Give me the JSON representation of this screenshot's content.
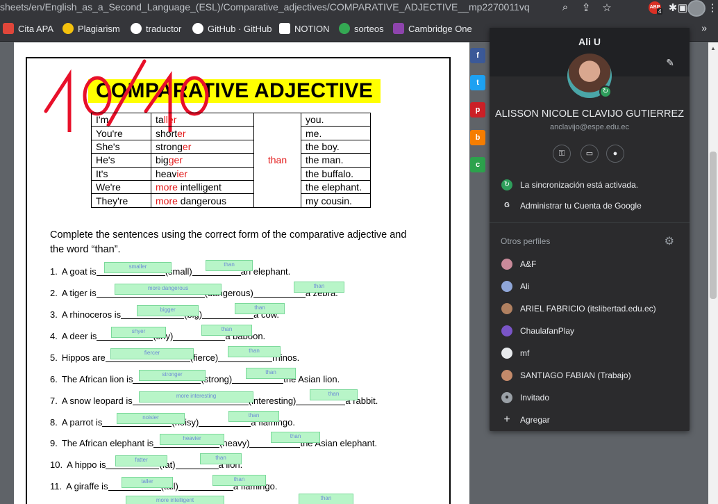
{
  "address_bar": {
    "url": "sheets/en/English_as_a_Second_Language_(ESL)/Comparative_adjectives/COMPARATIVE_ADJECTIVE__mp2270011vq",
    "ext_badge": "ABP",
    "ext_count": "4"
  },
  "bookmarks": [
    {
      "label": "Cita APA",
      "color": "#e0463a"
    },
    {
      "label": "Plagiarism",
      "color": "#f4c20d"
    },
    {
      "label": "traductor",
      "color": "#4285f4"
    },
    {
      "label": "GitHub · GitHub",
      "color": "#ffffff"
    },
    {
      "label": "NOTION",
      "color": "#ffffff"
    },
    {
      "label": "sorteos",
      "color": "#34a853"
    },
    {
      "label": "Cambridge One",
      "color": "#8e44ad"
    }
  ],
  "worksheet": {
    "title": "COMPARATIVE ADJECTIVE",
    "score": "10/10",
    "table": {
      "subjects": [
        "I'm",
        "You're",
        "She's",
        "He's",
        "It's",
        "We're",
        "They're"
      ],
      "adjectives": [
        {
          "base": "ta",
          "ending": "ller"
        },
        {
          "base": "short",
          "ending": "er"
        },
        {
          "base": "strong",
          "ending": "er"
        },
        {
          "base": "big",
          "ending": "ger"
        },
        {
          "base": "heav",
          "ending": "ier"
        },
        {
          "base": " intelligent",
          "ending": "more",
          "prefix": true
        },
        {
          "base": " dangerous",
          "ending": "more",
          "prefix": true
        }
      ],
      "than": "than",
      "objects": [
        "you.",
        "me.",
        "the boy.",
        "the man.",
        "the buffalo.",
        "the elephant.",
        "my cousin."
      ]
    },
    "instructions": "Complete the sentences using the correct form of the comparative adjective and the word “than”.",
    "questions": [
      {
        "num": "1.",
        "start": "A goat is",
        "word": "(small)",
        "end": "an elephant.",
        "answer": "smaller",
        "than": "than"
      },
      {
        "num": "2.",
        "start": "A tiger is",
        "word": "(dangerous)",
        "end": "a zebra.",
        "answer": "more dangerous",
        "than": "than"
      },
      {
        "num": "3.",
        "start": "A rhinoceros is",
        "word": "(big)",
        "end": "a cow.",
        "answer": "bigger",
        "than": "than"
      },
      {
        "num": "4.",
        "start": "A deer is",
        "word": "(shy)",
        "end": "a baboon.",
        "answer": "shyer",
        "than": "than"
      },
      {
        "num": "5.",
        "start": "Hippos are",
        "word": "(fierce)",
        "end": "rhinos.",
        "answer": "fiercer",
        "than": "than"
      },
      {
        "num": "6.",
        "start": "The African lion is",
        "word": "(strong)",
        "end": "the Asian lion.",
        "answer": "stronger",
        "than": "than"
      },
      {
        "num": "7.",
        "start": "A snow leopard is",
        "word": "(interesting)",
        "end": "a rabbit.",
        "answer": "more interesting",
        "than": "than"
      },
      {
        "num": "8.",
        "start": "A parrot is",
        "word": "(noisy)",
        "end": "a flamingo.",
        "answer": "noisier",
        "than": "than"
      },
      {
        "num": "9.",
        "start": "The African elephant is",
        "word": "(heavy)",
        "end": "the Asian elephant.",
        "answer": "heavier",
        "than": "than"
      },
      {
        "num": "10.",
        "start": "A hippo is",
        "word": "(fat)",
        "end": "a lion.",
        "answer": "fatter",
        "than": "than"
      },
      {
        "num": "11.",
        "start": "A giraffe is",
        "word": "(tall)",
        "end": "a flamingo.",
        "answer": "taller",
        "than": "than"
      },
      {
        "num": "",
        "start": "",
        "word": "",
        "end": "",
        "answer": "more intelligent",
        "than": "than"
      }
    ]
  },
  "share_buttons": [
    {
      "icon": "f",
      "color": "#3b5998"
    },
    {
      "icon": "t",
      "color": "#1da1f2"
    },
    {
      "icon": "p",
      "color": "#cb2027"
    },
    {
      "icon": "b",
      "color": "#f57d00"
    },
    {
      "icon": "c",
      "color": "#2ca24c"
    }
  ],
  "profile": {
    "account_short": "Ali U",
    "full_name": "ALISSON NICOLE CLAVIJO GUTIERREZ",
    "email": "anclavijo@espe.edu.ec",
    "sync_status": "La sincronización está activada.",
    "manage_account": "Administrar tu Cuenta de Google",
    "other_profiles_title": "Otros perfiles",
    "other_profiles": [
      {
        "name": "A&F",
        "color": "#c98a9a"
      },
      {
        "name": "Ali",
        "color": "#8fa6d8"
      },
      {
        "name": "ARIEL FABRICIO (itslibertad.edu.ec)",
        "color": "#b08060"
      },
      {
        "name": "ChaulafanPlay",
        "color": "#7a55c8"
      },
      {
        "name": "mf",
        "color": "#e8eaed"
      },
      {
        "name": "SANTIAGO FABIAN (Trabajo)",
        "color": "#c48a6a"
      }
    ],
    "guest": "Invitado",
    "add": "Agregar"
  }
}
